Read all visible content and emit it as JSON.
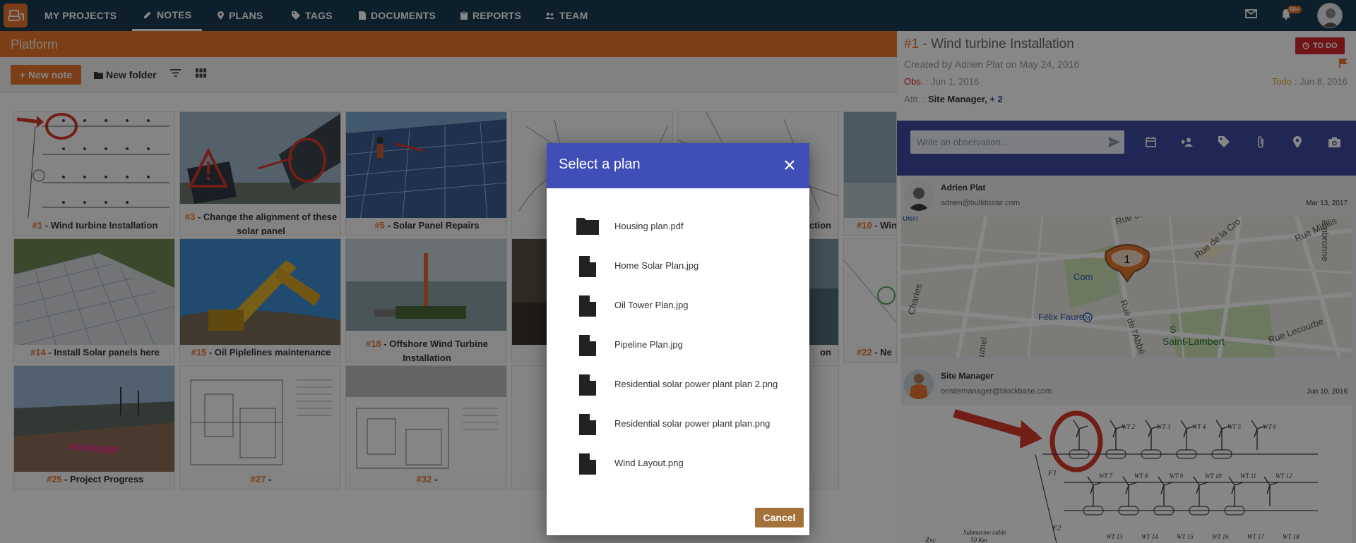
{
  "nav": {
    "my_projects": "MY PROJECTS",
    "notes": "NOTES",
    "plans": "PLANS",
    "tags": "TAGS",
    "documents": "DOCUMENTS",
    "reports": "REPORTS",
    "team": "TEAM",
    "notifications_badge": "50+"
  },
  "project": {
    "name": "Platform"
  },
  "toolbar": {
    "new_note": "New note",
    "new_folder": "New folder"
  },
  "cards": [
    {
      "num": "#1",
      "sep": " - ",
      "title": "Wind turbine Installation"
    },
    {
      "num": "#3",
      "sep": " - ",
      "title": "Change the alignment of these solar panel"
    },
    {
      "num": "#5",
      "sep": " - ",
      "title": "Solar Panel Repairs"
    },
    {
      "num": "",
      "sep": "",
      "title": ""
    },
    {
      "num": "",
      "sep": "",
      "title": "uction"
    },
    {
      "num": "#10",
      "sep": " - ",
      "title": "Win"
    },
    {
      "num": "#14",
      "sep": " - ",
      "title": "Install Solar panels here"
    },
    {
      "num": "#15",
      "sep": " - ",
      "title": "Oil Piplelines maintenance"
    },
    {
      "num": "#18",
      "sep": " - ",
      "title": "Offshore Wind Turbine Installation"
    },
    {
      "num": "",
      "sep": "",
      "title": ""
    },
    {
      "num": "",
      "sep": "",
      "title": "on"
    },
    {
      "num": "#22",
      "sep": " - ",
      "title": "Ne"
    },
    {
      "num": "#25",
      "sep": " - ",
      "title": "Project Progress"
    },
    {
      "num": "#27",
      "sep": " - ",
      "title": ""
    },
    {
      "num": "#32",
      "sep": " - ",
      "title": ""
    },
    {
      "num": "",
      "sep": "",
      "title": ""
    },
    {
      "num": "",
      "sep": "",
      "title": ""
    }
  ],
  "note": {
    "num": "#1",
    "sep": " - ",
    "title": "Wind turbine Installation",
    "status": "TO DO",
    "created": "Created by Adrien Plat on May 24, 2016",
    "obs_label": "Obs.",
    "obs_date": " : Jun 1, 2016",
    "todo_label": "Todo",
    "todo_date": " : Jun 8, 2016",
    "attr_label": "Attr. :",
    "attr_value": "Site Manager,",
    "attr_more": "+ 2",
    "observation_placeholder": "Write an observation..."
  },
  "feed": [
    {
      "name": "Adrien Plat",
      "email": "adrien@bulldozair.com",
      "date": "Mar 13, 2017"
    },
    {
      "name": "Site Manager",
      "email": "onsitemanager@blockbase.com",
      "date": "Jun 10, 2016"
    }
  ],
  "map": {
    "pin": "1",
    "labels": [
      "Rue du Théâtre",
      "Rue Miollis",
      "Rue de la Cro",
      "Félix Faure",
      "Square Saint-Lambert",
      "Rue Lecourbe",
      "Rue de l'Abbé",
      "Com",
      "Charles",
      "umel",
      "ambronne",
      "oen"
    ]
  },
  "wind": {
    "labels": [
      "WT 2",
      "WT 3",
      "WT 4",
      "WT 5",
      "WT 6",
      "WT 7",
      "WT 8",
      "WT 9",
      "WT 10",
      "WT 11",
      "WT 12",
      "F1",
      "F2",
      "Submarine cable",
      "50 Km",
      "Zsc",
      "WT 13",
      "WT 14",
      "WT 15",
      "WT 16",
      "WT 17",
      "WT 18"
    ]
  },
  "modal": {
    "title": "Select a plan",
    "items": [
      {
        "name": "Housing plan.pdf",
        "icon": "folder-icon"
      },
      {
        "name": "Home Solar Plan.jpg",
        "icon": "file-icon"
      },
      {
        "name": "Oil Tower Plan.jpg",
        "icon": "file-icon"
      },
      {
        "name": "Pipeline Plan.jpg",
        "icon": "file-icon"
      },
      {
        "name": "Residential solar power plant plan 2.png",
        "icon": "file-icon"
      },
      {
        "name": "Residential solar power plant plan.png",
        "icon": "file-icon"
      },
      {
        "name": "Wind Layout.png",
        "icon": "file-icon"
      }
    ],
    "cancel": "Cancel"
  },
  "colors": {
    "topbar": "#1a3b52",
    "accent": "#e8762b",
    "modal_header": "#3f4fb7",
    "observation_bar": "#3f4aa0",
    "todo": "#d7262a",
    "cancel": "#a5713a"
  }
}
